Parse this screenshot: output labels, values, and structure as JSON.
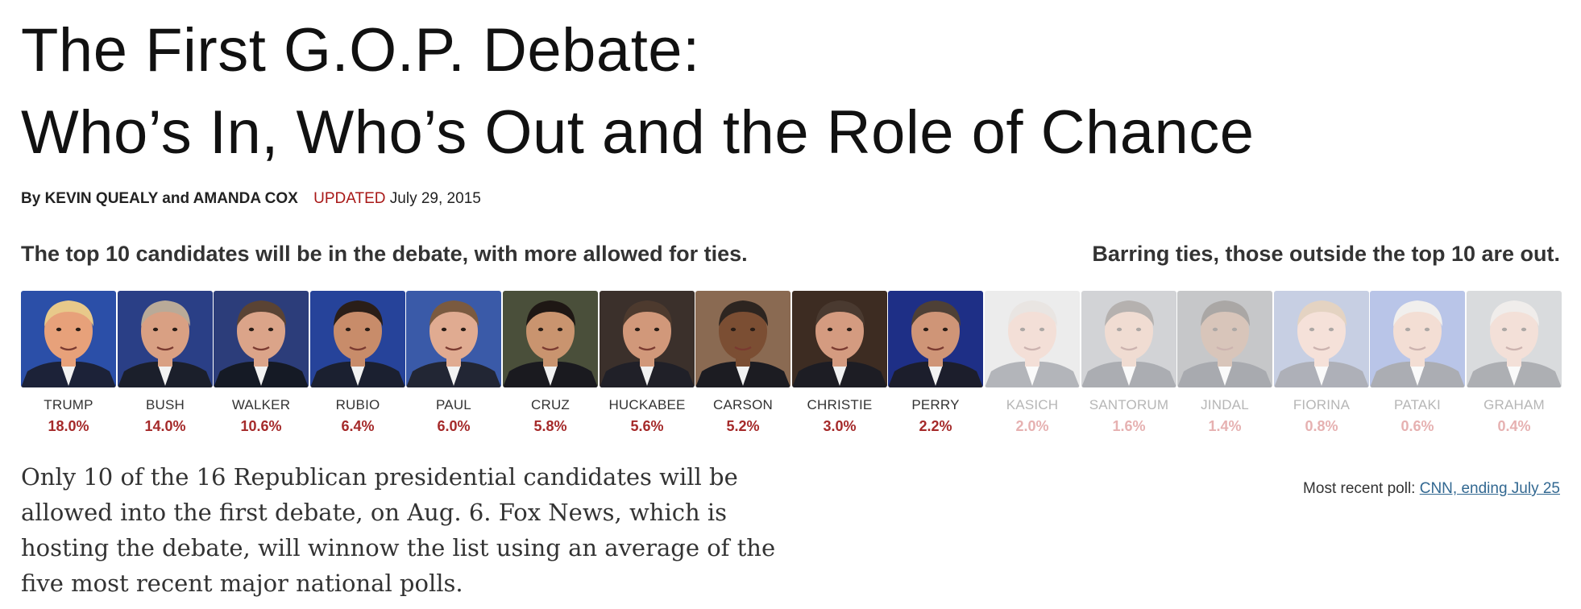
{
  "headline": {
    "line1": "The First G.O.P. Debate:",
    "line2": "Who’s In, Who’s Out and the Role of Chance"
  },
  "byline": {
    "by": "By",
    "author1": "KEVIN QUEALY",
    "and": "and",
    "author2": "AMANDA COX",
    "updated_label": "UPDATED",
    "date": "July 29, 2015"
  },
  "subheads": {
    "left": "The top 10 candidates will be in the debate, with more allowed for ties.",
    "right": "Barring ties, those outside the top 10 are out."
  },
  "candidates": [
    {
      "name": "TRUMP",
      "pct": "18.0%",
      "status": "in",
      "bg": "#2b4fa8",
      "skin": "#e7a17a",
      "hair": "#e8c98a",
      "suit": "#1c2238"
    },
    {
      "name": "BUSH",
      "pct": "14.0%",
      "status": "in",
      "bg": "#2a3f86",
      "skin": "#d9a083",
      "hair": "#b9aa98",
      "suit": "#1b1f2b"
    },
    {
      "name": "WALKER",
      "pct": "10.6%",
      "status": "in",
      "bg": "#2c3d7a",
      "skin": "#dba489",
      "hair": "#5a4334",
      "suit": "#151a25"
    },
    {
      "name": "RUBIO",
      "pct": "6.4%",
      "status": "in",
      "bg": "#26439a",
      "skin": "#c88c6a",
      "hair": "#2a1e18",
      "suit": "#1b2030"
    },
    {
      "name": "PAUL",
      "pct": "6.0%",
      "status": "in",
      "bg": "#3a5aa8",
      "skin": "#e0ab91",
      "hair": "#7a5a40",
      "suit": "#222634"
    },
    {
      "name": "CRUZ",
      "pct": "5.8%",
      "status": "in",
      "bg": "#4a4f3a",
      "skin": "#c9946f",
      "hair": "#1e1714",
      "suit": "#1a1a1f"
    },
    {
      "name": "HUCKABEE",
      "pct": "5.6%",
      "status": "in",
      "bg": "#3b302b",
      "skin": "#d1987a",
      "hair": "#4d3a2e",
      "suit": "#202028"
    },
    {
      "name": "CARSON",
      "pct": "5.2%",
      "status": "in",
      "bg": "#8a6a52",
      "skin": "#7b4e33",
      "hair": "#2d2520",
      "suit": "#1c1c22"
    },
    {
      "name": "CHRISTIE",
      "pct": "3.0%",
      "status": "in",
      "bg": "#3d2c22",
      "skin": "#d49b80",
      "hair": "#4a3a30",
      "suit": "#1d1d24"
    },
    {
      "name": "PERRY",
      "pct": "2.2%",
      "status": "in",
      "bg": "#1e2f86",
      "skin": "#cf9577",
      "hair": "#4e4036",
      "suit": "#1c1e2c"
    },
    {
      "name": "KASICH",
      "pct": "2.0%",
      "status": "out",
      "bg": "#cfcfcf",
      "skin": "#e0ad98",
      "hair": "#c7bcb4",
      "suit": "#3a3f4c"
    },
    {
      "name": "SANTORUM",
      "pct": "1.6%",
      "status": "out",
      "bg": "#8c8e96",
      "skin": "#d8a48c",
      "hair": "#3e3430",
      "suit": "#252a38"
    },
    {
      "name": "JINDAL",
      "pct": "1.4%",
      "status": "out",
      "bg": "#6b6f74",
      "skin": "#9a6a4c",
      "hair": "#221a16",
      "suit": "#1e2230"
    },
    {
      "name": "FIORINA",
      "pct": "0.8%",
      "status": "out",
      "bg": "#6d84b8",
      "skin": "#e6b39d",
      "hair": "#b98e60",
      "suit": "#2d3346"
    },
    {
      "name": "PATAKI",
      "pct": "0.6%",
      "status": "out",
      "bg": "#4a68c4",
      "skin": "#e1a98f",
      "hair": "#dcd6d0",
      "suit": "#262b3a"
    },
    {
      "name": "GRAHAM",
      "pct": "0.4%",
      "status": "out",
      "bg": "#9ea2a8",
      "skin": "#e0b09a",
      "hair": "#d8d2cc",
      "suit": "#2b2f3b"
    }
  ],
  "body": "Only 10 of the 16 Republican presidential candidates will be allowed into the first debate, on Aug. 6. Fox News, which is hosting the debate, will winnow the list using an average of the five most recent major national polls.",
  "poll": {
    "label": "Most recent poll:",
    "link": "CNN, ending July 25"
  }
}
